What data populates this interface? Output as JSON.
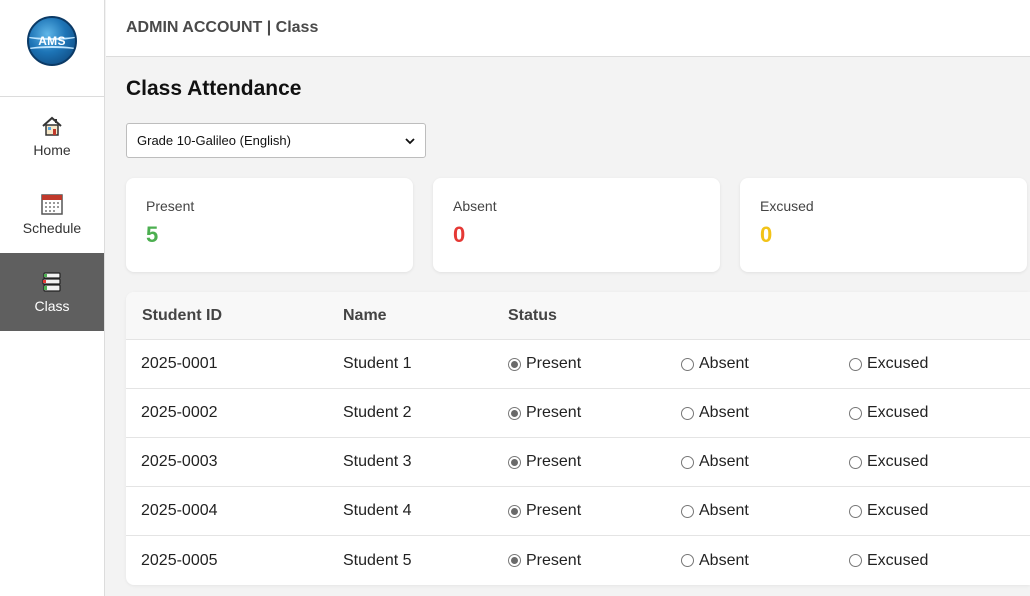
{
  "app": {
    "logo_text": "AMS",
    "header_title": "ADMIN ACCOUNT | Class"
  },
  "sidebar": {
    "items": [
      {
        "label": "Home",
        "icon": "home-icon",
        "active": false
      },
      {
        "label": "Schedule",
        "icon": "calendar-icon",
        "active": false
      },
      {
        "label": "Class",
        "icon": "books-icon",
        "active": true
      }
    ]
  },
  "page": {
    "title": "Class Attendance",
    "class_select": {
      "selected": "Grade 10-Galileo (English)"
    }
  },
  "summary": {
    "present": {
      "label": "Present",
      "value": "5",
      "color": "#4caf50"
    },
    "absent": {
      "label": "Absent",
      "value": "0",
      "color": "#e53935"
    },
    "excused": {
      "label": "Excused",
      "value": "0",
      "color": "#f2c318"
    }
  },
  "table": {
    "headers": {
      "id": "Student ID",
      "name": "Name",
      "status": "Status"
    },
    "options": {
      "present": "Present",
      "absent": "Absent",
      "excused": "Excused"
    },
    "rows": [
      {
        "id": "2025-0001",
        "name": "Student 1",
        "status": "Present"
      },
      {
        "id": "2025-0002",
        "name": "Student 2",
        "status": "Present"
      },
      {
        "id": "2025-0003",
        "name": "Student 3",
        "status": "Present"
      },
      {
        "id": "2025-0004",
        "name": "Student 4",
        "status": "Present"
      },
      {
        "id": "2025-0005",
        "name": "Student 5",
        "status": "Present"
      }
    ]
  }
}
